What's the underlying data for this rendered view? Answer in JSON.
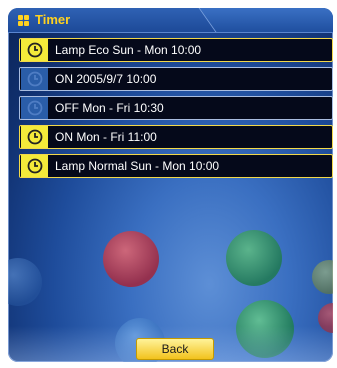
{
  "window": {
    "title": "Timer"
  },
  "timers": [
    {
      "label": "Lamp Eco Sun - Mon 10:00",
      "state": "active"
    },
    {
      "label": "ON 2005/9/7 10:00",
      "state": "inactive"
    },
    {
      "label": "OFF Mon - Fri 10:30",
      "state": "inactive"
    },
    {
      "label": "ON Mon - Fri 11:00",
      "state": "active"
    },
    {
      "label": "Lamp Normal Sun - Mon 10:00",
      "state": "active"
    }
  ],
  "buttons": {
    "back": "Back"
  },
  "icons": {
    "title": "grid-icon",
    "timer": "clock-icon"
  },
  "colors": {
    "accent_yellow": "#f4ea3a",
    "title_yellow": "#ffd21f",
    "inactive_blue": "#2a5da8"
  }
}
